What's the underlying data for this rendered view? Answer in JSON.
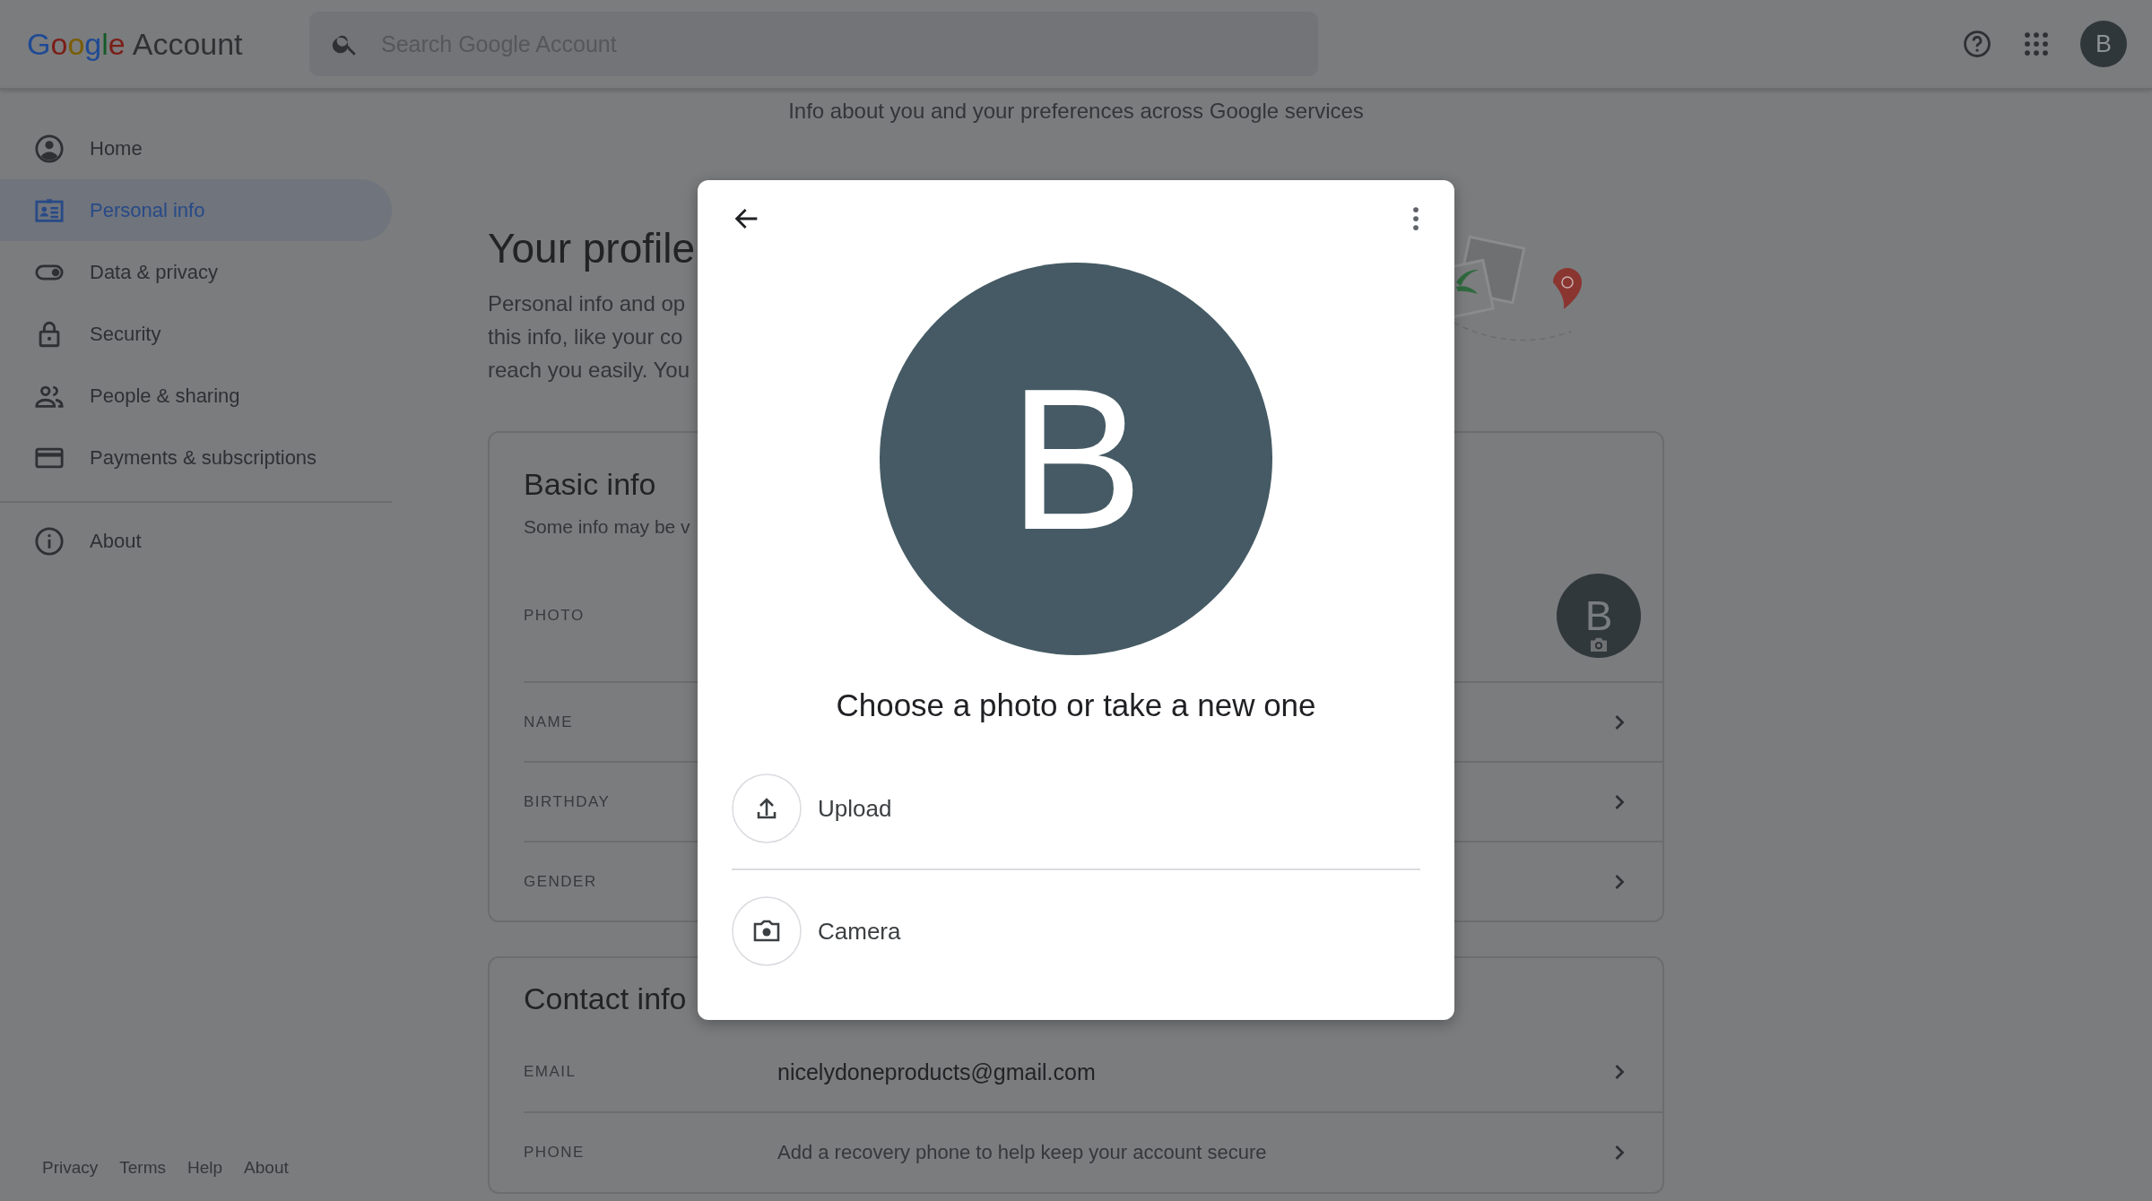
{
  "header": {
    "logo_brand": "Google",
    "logo_product": "Account",
    "search": {
      "placeholder": "Search Google Account"
    },
    "avatar_letter": "B"
  },
  "sidebar": {
    "items": [
      {
        "label": "Home",
        "selected": false
      },
      {
        "label": "Personal info",
        "selected": true
      },
      {
        "label": "Data & privacy",
        "selected": false
      },
      {
        "label": "Security",
        "selected": false
      },
      {
        "label": "People & sharing",
        "selected": false
      },
      {
        "label": "Payments & subscriptions",
        "selected": false
      }
    ],
    "secondary_items": [
      {
        "label": "About",
        "selected": false
      }
    ],
    "footer_links": [
      "Privacy",
      "Terms",
      "Help",
      "About"
    ]
  },
  "main": {
    "subtitle": "Info about you and your preferences across Google services",
    "profile_title": "Your profile",
    "profile_description": [
      "Personal info and op",
      "this info, like your co",
      "reach you easily. You"
    ],
    "basic_info": {
      "title": "Basic info",
      "subtitle": "Some info may be v",
      "rows": [
        {
          "label": "PHOTO",
          "kind": "photo",
          "avatar_letter": "B"
        },
        {
          "label": "NAME",
          "kind": "link"
        },
        {
          "label": "BIRTHDAY",
          "kind": "link"
        },
        {
          "label": "GENDER",
          "kind": "link"
        }
      ]
    },
    "contact_info": {
      "title": "Contact info",
      "rows": [
        {
          "label": "EMAIL",
          "value": "nicelydoneproducts@gmail.com",
          "kind": "value"
        },
        {
          "label": "PHONE",
          "value": "Add a recovery phone to help keep your account secure",
          "kind": "hint"
        }
      ]
    }
  },
  "dialog": {
    "avatar_letter": "B",
    "title": "Choose a photo or take a new one",
    "options": [
      {
        "label": "Upload",
        "kind": "upload"
      },
      {
        "label": "Camera",
        "kind": "camera"
      }
    ]
  }
}
